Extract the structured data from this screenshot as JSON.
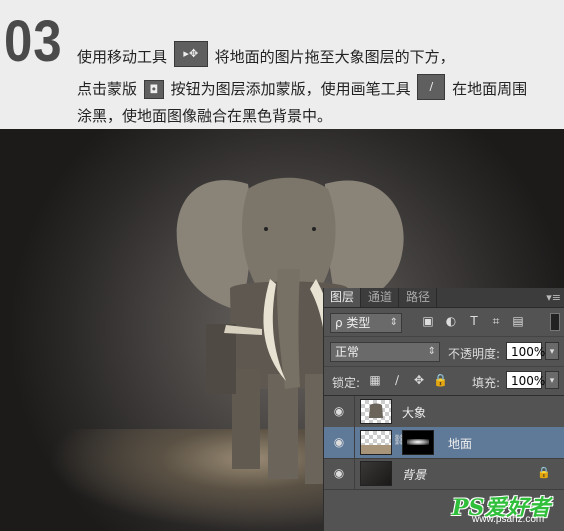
{
  "header": {
    "step_number": "03",
    "line1_a": "使用移动工具",
    "line1_b": "将地面的图片拖至大象图层的下方，",
    "line2_a": "点击蒙版",
    "line2_b": "按钮为图层添加蒙版，使用画笔工具",
    "line2_c": "在地面周围",
    "line3": "涂黑，使地面图像融合在黑色背景中。",
    "move_tool_glyph": "▸✥",
    "mask_tool_glyph": "◘",
    "brush_tool_glyph": "∕"
  },
  "layers_panel": {
    "tabs": [
      "图层",
      "通道",
      "路径"
    ],
    "menu_glyph": "▾≡",
    "filter_label": "ρ 类型",
    "blend_mode": "正常",
    "opacity_label": "不透明度:",
    "opacity_value": "100%",
    "lock_label": "锁定:",
    "fill_label": "填充:",
    "fill_value": "100%",
    "layers": [
      {
        "name": "大象",
        "selected": false,
        "locked": false
      },
      {
        "name": "地面",
        "selected": true,
        "locked": false
      },
      {
        "name": "背景",
        "selected": false,
        "locked": true
      }
    ]
  },
  "watermark": {
    "logo": "PS爱好者",
    "url": "www.psahz.com"
  },
  "colors": {
    "panel_bg": "#535353",
    "selected_layer": "#5f7a99",
    "watermark_green": "#2fbf3a"
  }
}
